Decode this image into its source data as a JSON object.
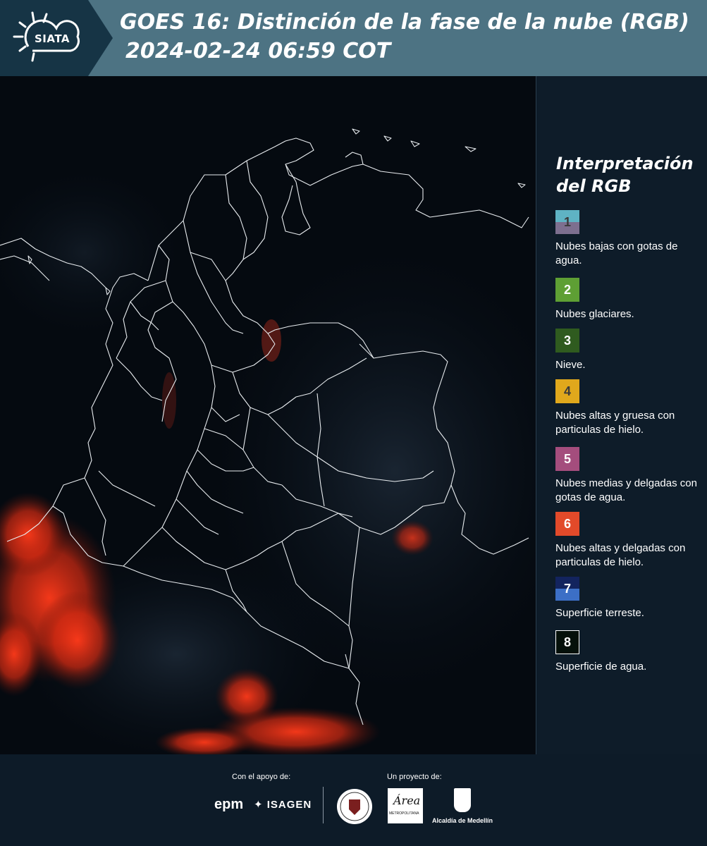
{
  "header": {
    "logo_text": "SIATA",
    "title_line1": "GOES 16: Distinción de la fase de la nube (RGB)",
    "title_line2": "2024-02-24 06:59 COT"
  },
  "legend": {
    "title_line1": "Interpretación",
    "title_line2": "del RGB",
    "items": [
      {
        "number": "1",
        "label": "Nubes bajas con gotas de agua.",
        "colors": [
          "#5fb3c4",
          "#7d6f8f"
        ],
        "num_color": "#3a3a3a"
      },
      {
        "number": "2",
        "label": "Nubes glaciares.",
        "colors": [
          "#5e9f34"
        ],
        "num_color": "#ffffff"
      },
      {
        "number": "3",
        "label": "Nieve.",
        "colors": [
          "#2f5b1f"
        ],
        "num_color": "#ffffff"
      },
      {
        "number": "4",
        "label": "Nubes altas y gruesa con particulas de hielo.",
        "colors": [
          "#e0a81c"
        ],
        "num_color": "#3a3a3a"
      },
      {
        "number": "5",
        "label": "Nubes medias y delgadas con gotas de agua.",
        "colors": [
          "#a44d7d"
        ],
        "num_color": "#ffffff"
      },
      {
        "number": "6",
        "label": "Nubes altas y delgadas con particulas de hielo.",
        "colors": [
          "#e24a2a"
        ],
        "num_color": "#ffffff"
      },
      {
        "number": "7",
        "label": "Superficie terreste.",
        "colors": [
          "#13245e",
          "#3c6fc6"
        ],
        "num_color": "#ffffff"
      },
      {
        "number": "8",
        "label": "Superficie de agua.",
        "colors": [
          "#05100a"
        ],
        "num_color": "#ffffff",
        "border": "#ffffff"
      }
    ]
  },
  "footer": {
    "support_label": "Con el apoyo de:",
    "project_label": "Un proyecto de:",
    "epm": "epm",
    "isagen": "ISAGEN",
    "area_word": "Área",
    "area_sub": "METROPOLITANA",
    "alcaldia": "Alcaldía de Medellín"
  }
}
